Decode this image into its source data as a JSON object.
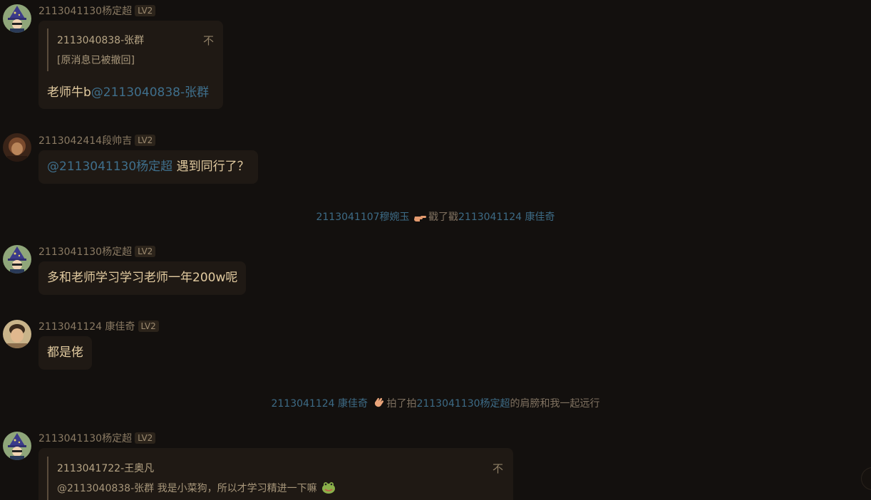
{
  "level_badge": "LV2",
  "messages": [
    {
      "sender": "2113041130杨定超",
      "quote": {
        "name": "2113040838-张群",
        "text": "[原消息已被撤回]",
        "arrow": "不"
      },
      "text": "老师牛b",
      "mention": "@2113040838-张群"
    },
    {
      "sender": "2113042414段帅吉",
      "mention": "@2113041130杨定超",
      "text": " 遇到同行了？"
    },
    {
      "sender": "2113041130杨定超",
      "text": "多和老师学习学习老师一年200w呢"
    },
    {
      "sender": "2113041124 康佳奇",
      "text": "都是佬"
    },
    {
      "sender": "2113041130杨定超",
      "quote": {
        "name": "2113041722-王奥凡",
        "text": "@2113040838-张群 我是小菜狗，所以才学习精进一下嘛",
        "arrow": "不"
      }
    }
  ],
  "system": [
    {
      "actor": "2113041107穆婉玉",
      "emoji": "pointing-hand-emoji",
      "action": "戳了戳",
      "target": "2113041124 康佳奇",
      "suffix": ""
    },
    {
      "actor": "2113041124 康佳奇",
      "emoji": "waving-hand-emoji",
      "action": "拍了拍",
      "target": "2113041130杨定超",
      "suffix": "的肩膀和我一起远行"
    }
  ],
  "colors": {
    "background": "#13100e",
    "bubble": "#1f1914",
    "mention": "#3f6f8c",
    "text": "#e2cba0"
  }
}
